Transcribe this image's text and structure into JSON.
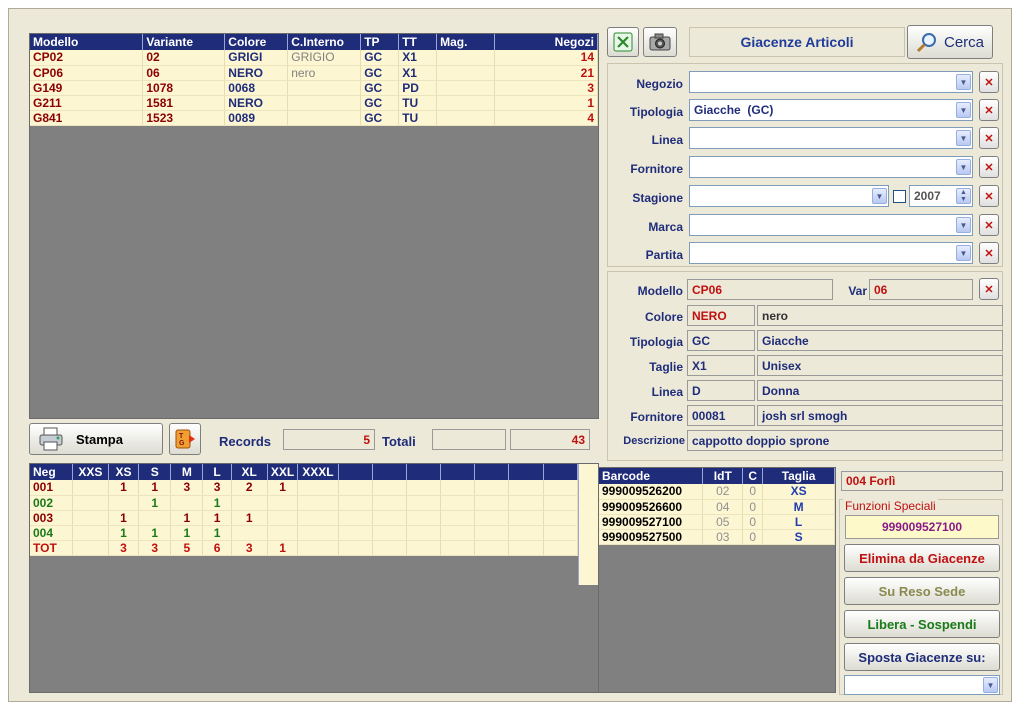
{
  "articles_table": {
    "columns": [
      "Modello",
      "Variante",
      "Colore",
      "C.Interno",
      "TP",
      "TT",
      "Mag.",
      "Negozi"
    ],
    "rows": [
      [
        "CP02",
        "02",
        "GRIGI",
        "GRIGIO",
        "GC",
        "X1",
        "",
        "14"
      ],
      [
        "CP06",
        "06",
        "NERO",
        "nero",
        "GC",
        "X1",
        "",
        "21"
      ],
      [
        "G149",
        "1078",
        "0068",
        "",
        "GC",
        "PD",
        "",
        "3"
      ],
      [
        "G211",
        "1581",
        "NERO",
        "",
        "GC",
        "TU",
        "",
        "1"
      ],
      [
        "G841",
        "1523",
        "0089",
        "",
        "GC",
        "TU",
        "",
        "4"
      ]
    ]
  },
  "toolbar": {
    "print_label": "Stampa",
    "records_label": "Records",
    "records_value": "5",
    "totals_label": "Totali",
    "totals_value": "",
    "totals_sum": "43"
  },
  "size_table": {
    "columns": [
      "Neg",
      "XXS",
      "XS",
      "S",
      "M",
      "L",
      "XL",
      "XXL",
      "XXXL",
      "",
      "",
      "",
      "",
      "",
      "",
      ""
    ],
    "rows": [
      [
        "001",
        "",
        "1",
        "1",
        "3",
        "3",
        "2",
        "1",
        "",
        "",
        "",
        "",
        "",
        "",
        "",
        ""
      ],
      [
        "002",
        "",
        "",
        "1",
        "",
        "1",
        "",
        "",
        "",
        "",
        "",
        "",
        "",
        "",
        "",
        ""
      ],
      [
        "003",
        "",
        "1",
        "",
        "1",
        "1",
        "1",
        "",
        "",
        "",
        "",
        "",
        "",
        "",
        "",
        ""
      ],
      [
        "004",
        "",
        "1",
        "1",
        "1",
        "1",
        "",
        "",
        "",
        "",
        "",
        "",
        "",
        "",
        "",
        ""
      ],
      [
        "TOT",
        "",
        "3",
        "3",
        "5",
        "6",
        "3",
        "1",
        "",
        "",
        "",
        "",
        "",
        "",
        "",
        ""
      ]
    ],
    "row_colors": [
      "#8b0000",
      "#1a7a1a",
      "#8b0000",
      "#1a7a1a",
      "#c01010"
    ]
  },
  "header": {
    "title": "Giacenze Articoli",
    "search_label": "Cerca"
  },
  "filters": {
    "negozio": {
      "label": "Negozio",
      "value": ""
    },
    "tipologia": {
      "label": "Tipologia",
      "value": "Giacche  (GC)"
    },
    "linea": {
      "label": "Linea",
      "value": ""
    },
    "fornitore": {
      "label": "Fornitore",
      "value": ""
    },
    "stagione": {
      "label": "Stagione",
      "value": "",
      "year": "2007"
    },
    "marca": {
      "label": "Marca",
      "value": ""
    },
    "partita": {
      "label": "Partita",
      "value": ""
    }
  },
  "detail": {
    "modello": {
      "label": "Modello",
      "value": "CP06"
    },
    "var": {
      "label": "Var",
      "value": "06"
    },
    "colore": {
      "label": "Colore",
      "code": "NERO",
      "desc": "nero"
    },
    "tipologia": {
      "label": "Tipologia",
      "code": "GC",
      "desc": "Giacche"
    },
    "taglie": {
      "label": "Taglie",
      "code": "X1",
      "desc": "Unisex"
    },
    "linea": {
      "label": "Linea",
      "code": "D",
      "desc": "Donna"
    },
    "fornitore": {
      "label": "Fornitore",
      "code": "00081",
      "desc": "josh srl smogh"
    },
    "descrizione": {
      "label": "Descrizione",
      "value": "cappotto doppio sprone"
    }
  },
  "barcode_table": {
    "columns": [
      "Barcode",
      "IdT",
      "C",
      "Taglia"
    ],
    "rows": [
      [
        "999009526200",
        "02",
        "0",
        "XS"
      ],
      [
        "999009526600",
        "04",
        "0",
        "M"
      ],
      [
        "999009527100",
        "05",
        "0",
        "L"
      ],
      [
        "999009527500",
        "03",
        "0",
        "S"
      ]
    ]
  },
  "special": {
    "store": "004  Forlì",
    "title": "Funzioni Speciali",
    "barcode": "999009527100",
    "remove_label": "Elimina da Giacenze",
    "return_label": "Su Reso Sede",
    "release_label": "Libera - Sospendi",
    "move_label": "Sposta Giacenze su:",
    "move_target": ""
  }
}
